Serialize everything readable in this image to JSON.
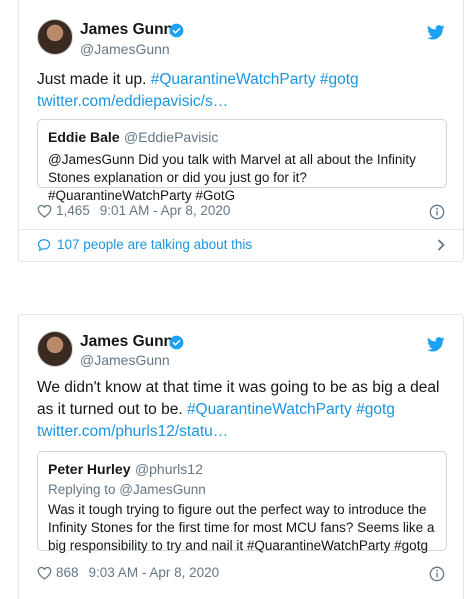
{
  "tweets": [
    {
      "author_name": "James Gunn",
      "author_handle": "@JamesGunn",
      "text_lines": [
        [
          "Just made it up. ",
          "#QuarantineWatchParty",
          " ",
          "#gotg"
        ],
        "twitter.com/eddiepavisic/s..."
      ],
      "text_plain": "Just made it up. ",
      "hashtag1": "#QuarantineWatchParty",
      "hashtag2": "#gotg",
      "link": "twitter.com/eddiepavisic/s…",
      "quote": {
        "name": "Eddie Bale",
        "handle": "@EddiePavisic",
        "text": "@JamesGunn Did you talk with Marvel at all about the Infinity Stones explanation or did you just go for it? #QuarantineWatchParty #GotG"
      },
      "likes": "1,465",
      "timestamp": "9:01 AM - Apr 8, 2020",
      "talking": "107 people are talking about this"
    },
    {
      "author_name": "James Gunn",
      "author_handle": "@JamesGunn",
      "text_plain": "We didn't know at that time it was going to be as big a deal as it turned out to be. ",
      "hashtag1": "#QuarantineWatchParty",
      "hashtag2": "#gotg",
      "link": "twitter.com/phurls12/statu…",
      "quote": {
        "name": "Peter Hurley",
        "handle": "@phurls12",
        "reply_to": "Replying to @JamesGunn",
        "text": "Was it tough trying to figure out the perfect way to introduce the Infinity Stones for the first time for most MCU fans? Seems like a big responsibility to try and nail it #QuarantineWatchParty #gotg"
      },
      "likes": "868",
      "timestamp": "9:03 AM - Apr 8, 2020"
    }
  ],
  "colors": {
    "link": "#1b95e0",
    "secondary_text": "#657786",
    "border": "#e1e8ed"
  },
  "icons": [
    "verified-icon",
    "twitter-bird-icon",
    "heart-icon",
    "info-icon",
    "reply-bubble-icon",
    "chevron-right-icon"
  ]
}
